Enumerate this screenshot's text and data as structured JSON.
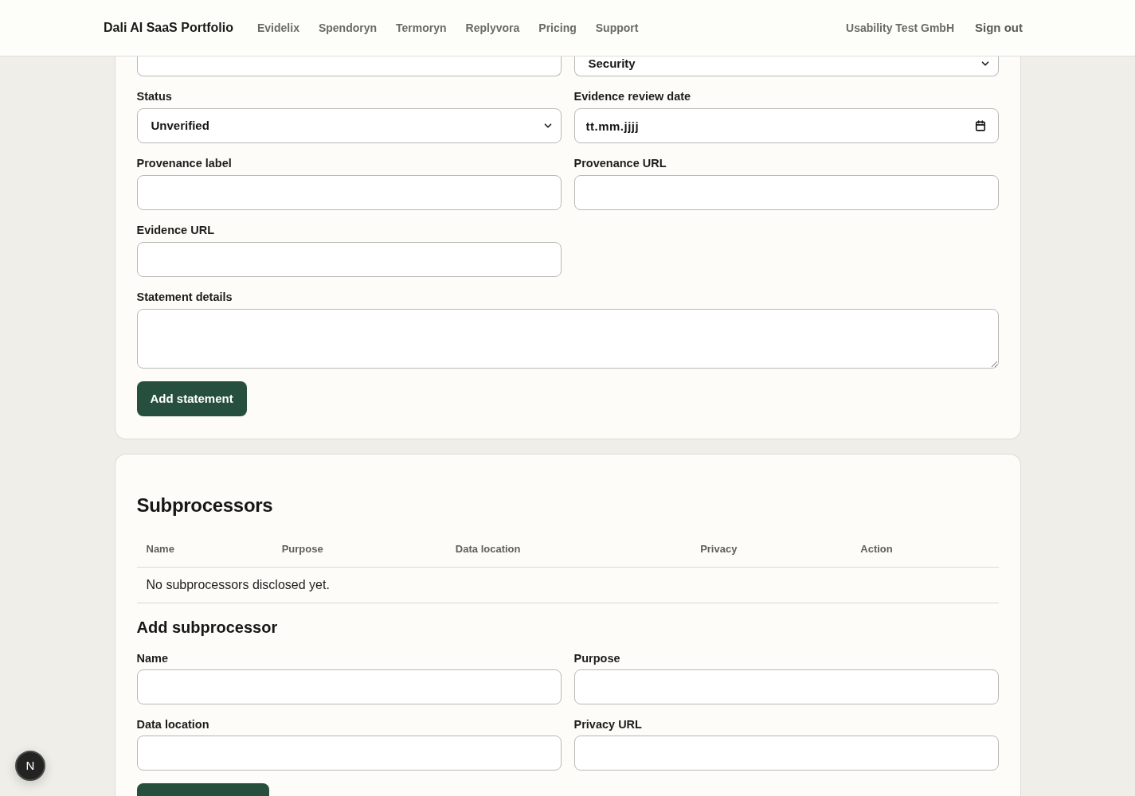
{
  "header": {
    "brand": "Dali AI SaaS Portfolio",
    "nav": [
      {
        "label": "Evidelix"
      },
      {
        "label": "Spendoryn"
      },
      {
        "label": "Termoryn"
      },
      {
        "label": "Replyvora"
      },
      {
        "label": "Pricing"
      },
      {
        "label": "Support"
      }
    ],
    "account": "Usability Test GmbH",
    "sign_out": "Sign out"
  },
  "statement_form": {
    "top_row": [
      {
        "kind": "text"
      },
      {
        "kind": "select",
        "value": "Security"
      }
    ],
    "fields": [
      {
        "label": "Status",
        "kind": "select",
        "value": "Unverified"
      },
      {
        "label": "Evidence review date",
        "kind": "date",
        "placeholder": "tt.mm.jjjj"
      },
      {
        "label": "Provenance label",
        "kind": "text"
      },
      {
        "label": "Provenance URL",
        "kind": "text"
      },
      {
        "label": "Evidence URL",
        "kind": "text"
      },
      {
        "label": "Statement details",
        "kind": "textarea"
      }
    ],
    "submit": "Add statement"
  },
  "subprocessors": {
    "title": "Subprocessors",
    "table": {
      "columns": [
        "Name",
        "Purpose",
        "Data location",
        "Privacy",
        "Action"
      ],
      "empty_message": "No subprocessors disclosed yet."
    },
    "add_form": {
      "title": "Add subprocessor",
      "fields": [
        {
          "label": "Name",
          "kind": "text"
        },
        {
          "label": "Purpose",
          "kind": "text"
        },
        {
          "label": "Data location",
          "kind": "text"
        },
        {
          "label": "Privacy URL",
          "kind": "text"
        }
      ]
    }
  },
  "dev_badge": {
    "label": "N"
  }
}
